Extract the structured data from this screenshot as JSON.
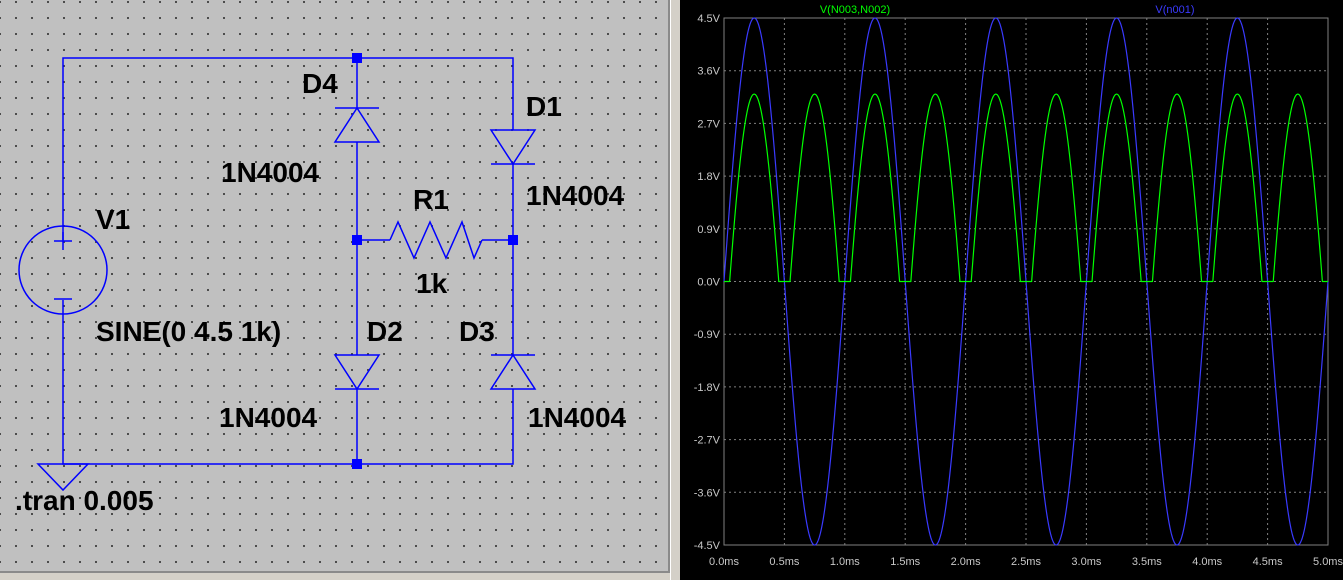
{
  "schematic": {
    "components": {
      "v1": {
        "name": "V1",
        "value": "SINE(0 4.5 1k)"
      },
      "d1": {
        "name": "D1",
        "model": "1N4004"
      },
      "d2": {
        "name": "D2",
        "model": "1N4004"
      },
      "d3": {
        "name": "D3",
        "model": "1N4004"
      },
      "d4": {
        "name": "D4",
        "model": "1N4004"
      },
      "r1": {
        "name": "R1",
        "value": "1k"
      }
    },
    "directive": ".tran 0.005",
    "colors": {
      "wire": "#0000ff",
      "symbol": "#0000ff",
      "junction": "#0000ff",
      "background": "#c0c0c0"
    }
  },
  "plot": {
    "background": "#000000",
    "grid_color": "#808080",
    "y_tick_labels": [
      "4.5V",
      "3.6V",
      "2.7V",
      "1.8V",
      "0.9V",
      "0.0V",
      "-0.9V",
      "-1.8V",
      "-2.7V",
      "-3.6V",
      "-4.5V"
    ],
    "x_tick_labels": [
      "0.0ms",
      "0.5ms",
      "1.0ms",
      "1.5ms",
      "2.0ms",
      "2.5ms",
      "3.0ms",
      "3.5ms",
      "4.0ms",
      "4.5ms",
      "5.0ms"
    ],
    "traces": [
      {
        "name": "V(N003,N002)",
        "color": "#00ff00"
      },
      {
        "name": "V(n001)",
        "color": "#3a3aff"
      }
    ]
  },
  "chart_data": {
    "type": "line",
    "xlabel": "",
    "ylabel": "",
    "xlim": [
      0,
      5
    ],
    "ylim": [
      -4.5,
      4.5
    ],
    "grid": true,
    "x_unit": "ms",
    "y_unit": "V",
    "series": [
      {
        "name": "V(n001)",
        "color": "#3a3aff",
        "kind": "sine",
        "amplitude": 4.5,
        "frequency_khz": 1
      },
      {
        "name": "V(N003,N002)",
        "color": "#00ff00",
        "kind": "full-wave-rectified",
        "peak": 3.2,
        "conduction_threshold": 1.3,
        "frequency_khz": 1
      }
    ]
  }
}
